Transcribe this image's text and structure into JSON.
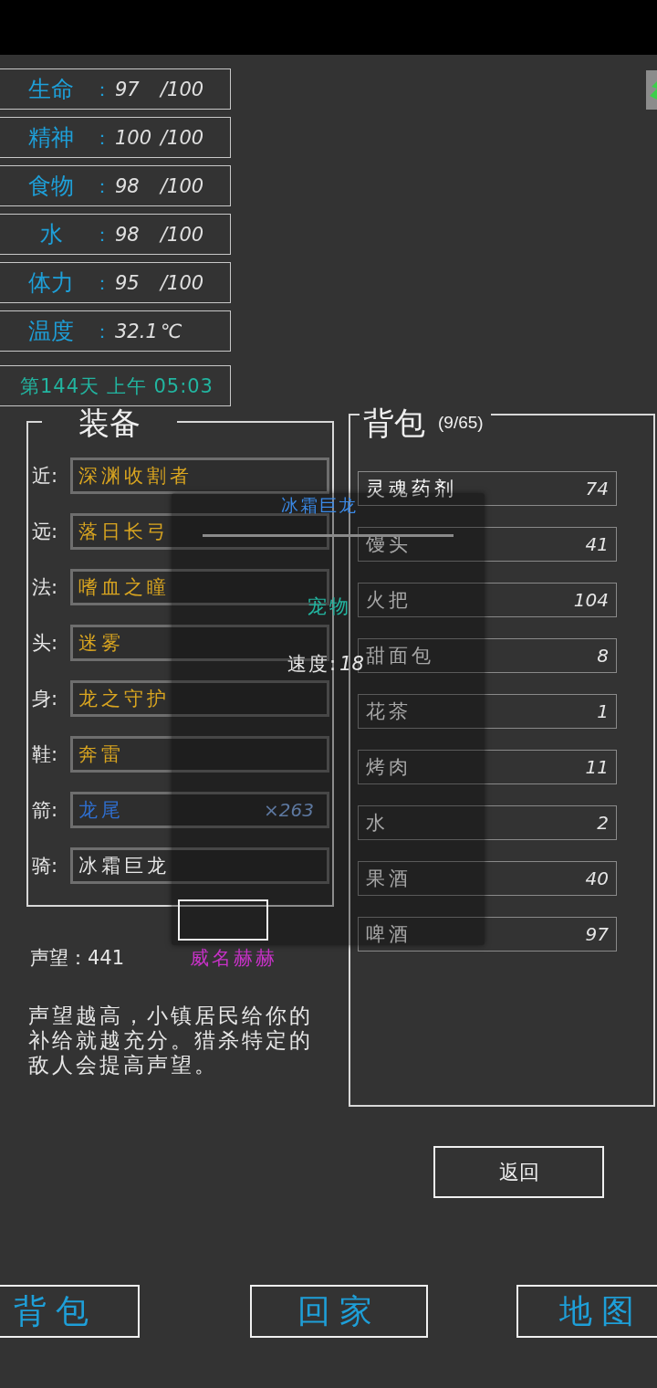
{
  "stats": [
    {
      "label": "生命",
      "colon": "：",
      "value": "97",
      "suffix": "/100"
    },
    {
      "label": "精神",
      "colon": "：",
      "value": "100",
      "suffix": "/100"
    },
    {
      "label": "食物",
      "colon": "：",
      "value": "98",
      "suffix": "/100"
    },
    {
      "label": "水",
      "colon": "：",
      "value": "98",
      "suffix": "/100"
    },
    {
      "label": "体力",
      "colon": "：",
      "value": "95",
      "suffix": "/100"
    },
    {
      "label": "温度",
      "colon": "：",
      "value": "32.1",
      "suffix": "℃"
    }
  ],
  "clock": "第144天 上午 05:03",
  "equipment": {
    "title": "装备",
    "slots": [
      {
        "label": "近:",
        "item": "深渊收割者",
        "color": "#d9a520"
      },
      {
        "label": "远:",
        "item": "落日长弓",
        "color": "#d9a520"
      },
      {
        "label": "法:",
        "item": "嗜血之瞳",
        "color": "#d9a520"
      },
      {
        "label": "头:",
        "item": "迷雾",
        "color": "#d9a520"
      },
      {
        "label": "身:",
        "item": "龙之守护",
        "color": "#d9a520"
      },
      {
        "label": "鞋:",
        "item": "奔雷",
        "color": "#d9a520"
      },
      {
        "label": "箭:",
        "item": "龙尾",
        "color": "#2f6fd0",
        "count": "×263"
      },
      {
        "label": "骑:",
        "item": "冰霜巨龙",
        "color": "#e6e6e6"
      }
    ]
  },
  "backpack": {
    "title": "背包",
    "capacity": "(9/65)",
    "items": [
      {
        "name": "灵魂药剂",
        "count": "74"
      },
      {
        "name": "馒头",
        "count": "41"
      },
      {
        "name": "火把",
        "count": "104"
      },
      {
        "name": "甜面包",
        "count": "8"
      },
      {
        "name": "花茶",
        "count": "1"
      },
      {
        "name": "烤肉",
        "count": "11"
      },
      {
        "name": "水",
        "count": "2"
      },
      {
        "name": "果酒",
        "count": "40"
      },
      {
        "name": "啤酒",
        "count": "97"
      }
    ]
  },
  "tooltip": {
    "title": "冰霜巨龙",
    "type": "宠物",
    "stats": [
      {
        "label": "速度:",
        "value": "18"
      }
    ]
  },
  "reputation": {
    "label": "声望：441",
    "title": "威名赫赫",
    "description": "声望越高，小镇居民给你的补给就越充分。猎杀特定的敌人会提高声望。"
  },
  "back_button": "返回",
  "nav": [
    {
      "label": "背包"
    },
    {
      "label": "回家"
    },
    {
      "label": "地图"
    }
  ]
}
